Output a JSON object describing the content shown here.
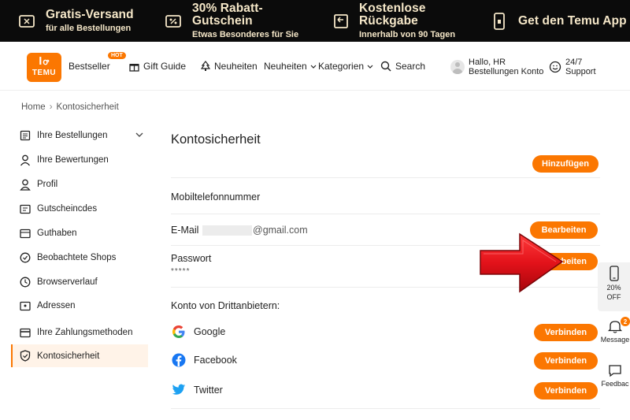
{
  "promo": [
    {
      "title": "Gratis-Versand",
      "sub": "für alle Bestellungen",
      "icon": "ticket-icon"
    },
    {
      "title": "30% Rabatt-Gutschein",
      "sub": "Etwas Besonderes für Sie",
      "icon": "coupon-icon"
    },
    {
      "title": "Kostenlose Rückgabe",
      "sub": "Innerhalb von 90 Tagen",
      "icon": "return-box-icon"
    },
    {
      "title": "Get den Temu App",
      "sub": "",
      "icon": "phone-icon"
    }
  ],
  "header": {
    "logo_top": "ꟾꝍ",
    "logo_text": "TEMU",
    "hot_badge": "HOT",
    "nav": {
      "bestseller": "Bestseller",
      "gift_guide": "Gift Guide",
      "neuheiten_1": "Neuheiten",
      "neuheiten_2": "Neuheiten",
      "kategorien": "Kategorien",
      "search": "Search"
    },
    "user_line1": "Hallo, HR",
    "user_line2": "Bestellungen Konto",
    "support_line1": "24/7",
    "support_line2": "Support"
  },
  "breadcrumb": {
    "home": "Home",
    "sep": "›",
    "current": "Kontosicherheit"
  },
  "sidebar": {
    "items": [
      {
        "label": "Ihre Bestellungen",
        "icon": "orders-icon"
      },
      {
        "label": "Ihre Bewertungen",
        "icon": "person-icon"
      },
      {
        "label": "Profil",
        "icon": "profile-icon"
      },
      {
        "label": "Gutscheincdes",
        "icon": "coupon-icon"
      },
      {
        "label": "Guthaben",
        "icon": "wallet-icon"
      },
      {
        "label": "Beobachtete Shops",
        "icon": "shop-icon"
      },
      {
        "label": "Browserverlauf",
        "icon": "clock-icon"
      },
      {
        "label": "Adressen",
        "icon": "address-icon"
      },
      {
        "label": "Ihre Zahlungsmethoden",
        "icon": "card-icon"
      },
      {
        "label": "Kontosicherheit",
        "icon": "shield-icon"
      }
    ]
  },
  "main": {
    "title": "Kontosicherheit",
    "add_button": "Hinzufügen",
    "phone_label": "Mobiltelefonnummer",
    "email_label": "E-Mail",
    "email_domain": "@gmail.com",
    "edit_button": "Bearbeiten",
    "password_label": "Passwort",
    "password_value": "*****",
    "password_button": "rbeiten",
    "third_party_label": "Konto von Drittanbietern:",
    "socials": [
      {
        "name": "Google",
        "button": "Verbinden",
        "icon": "google-icon"
      },
      {
        "name": "Facebook",
        "button": "Verbinden",
        "icon": "facebook-icon"
      },
      {
        "name": "Twitter",
        "button": "Verbinden",
        "icon": "twitter-icon"
      }
    ]
  },
  "floating": {
    "promo_l1": "20%",
    "promo_l2": "OFF",
    "message_badge": "2",
    "message_label": "Message",
    "feedback_label": "Feedbac"
  },
  "colors": {
    "accent": "#fb7701",
    "promo_bg": "#0b0b0b",
    "promo_text": "#f5e7c8",
    "active_bg": "#fff3e8",
    "arrow_red": "#d8141c"
  }
}
